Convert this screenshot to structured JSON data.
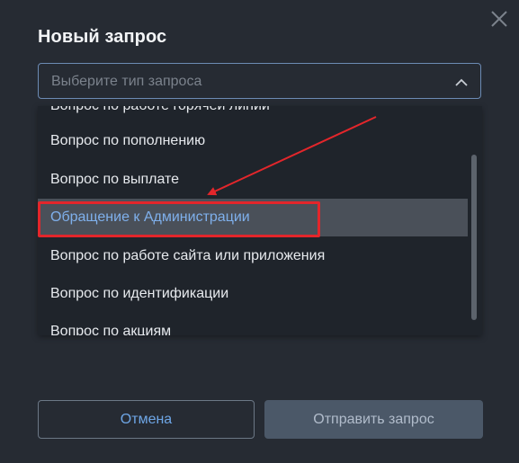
{
  "dialog": {
    "title": "Новый запрос",
    "close_icon": "close-icon"
  },
  "select": {
    "placeholder": "Выберите тип запроса",
    "chevron_icon": "chevron-up-icon",
    "border_color": "#6c8bb4"
  },
  "dropdown": {
    "options": [
      {
        "label": "Вопрос по работе горячей линии"
      },
      {
        "label": "Вопрос по пополнению"
      },
      {
        "label": "Вопрос по выплате"
      },
      {
        "label": "Обращение к Администрации"
      },
      {
        "label": "Вопрос по работе сайта или приложения"
      },
      {
        "label": "Вопрос по идентификации"
      },
      {
        "label": "Вопрос по акциям"
      }
    ],
    "selected_index": 3,
    "selected_text_color": "#7fb0ec"
  },
  "annotation": {
    "highlight_color": "#e3262b"
  },
  "buttons": {
    "cancel_label": "Отмена",
    "submit_label": "Отправить запрос"
  }
}
